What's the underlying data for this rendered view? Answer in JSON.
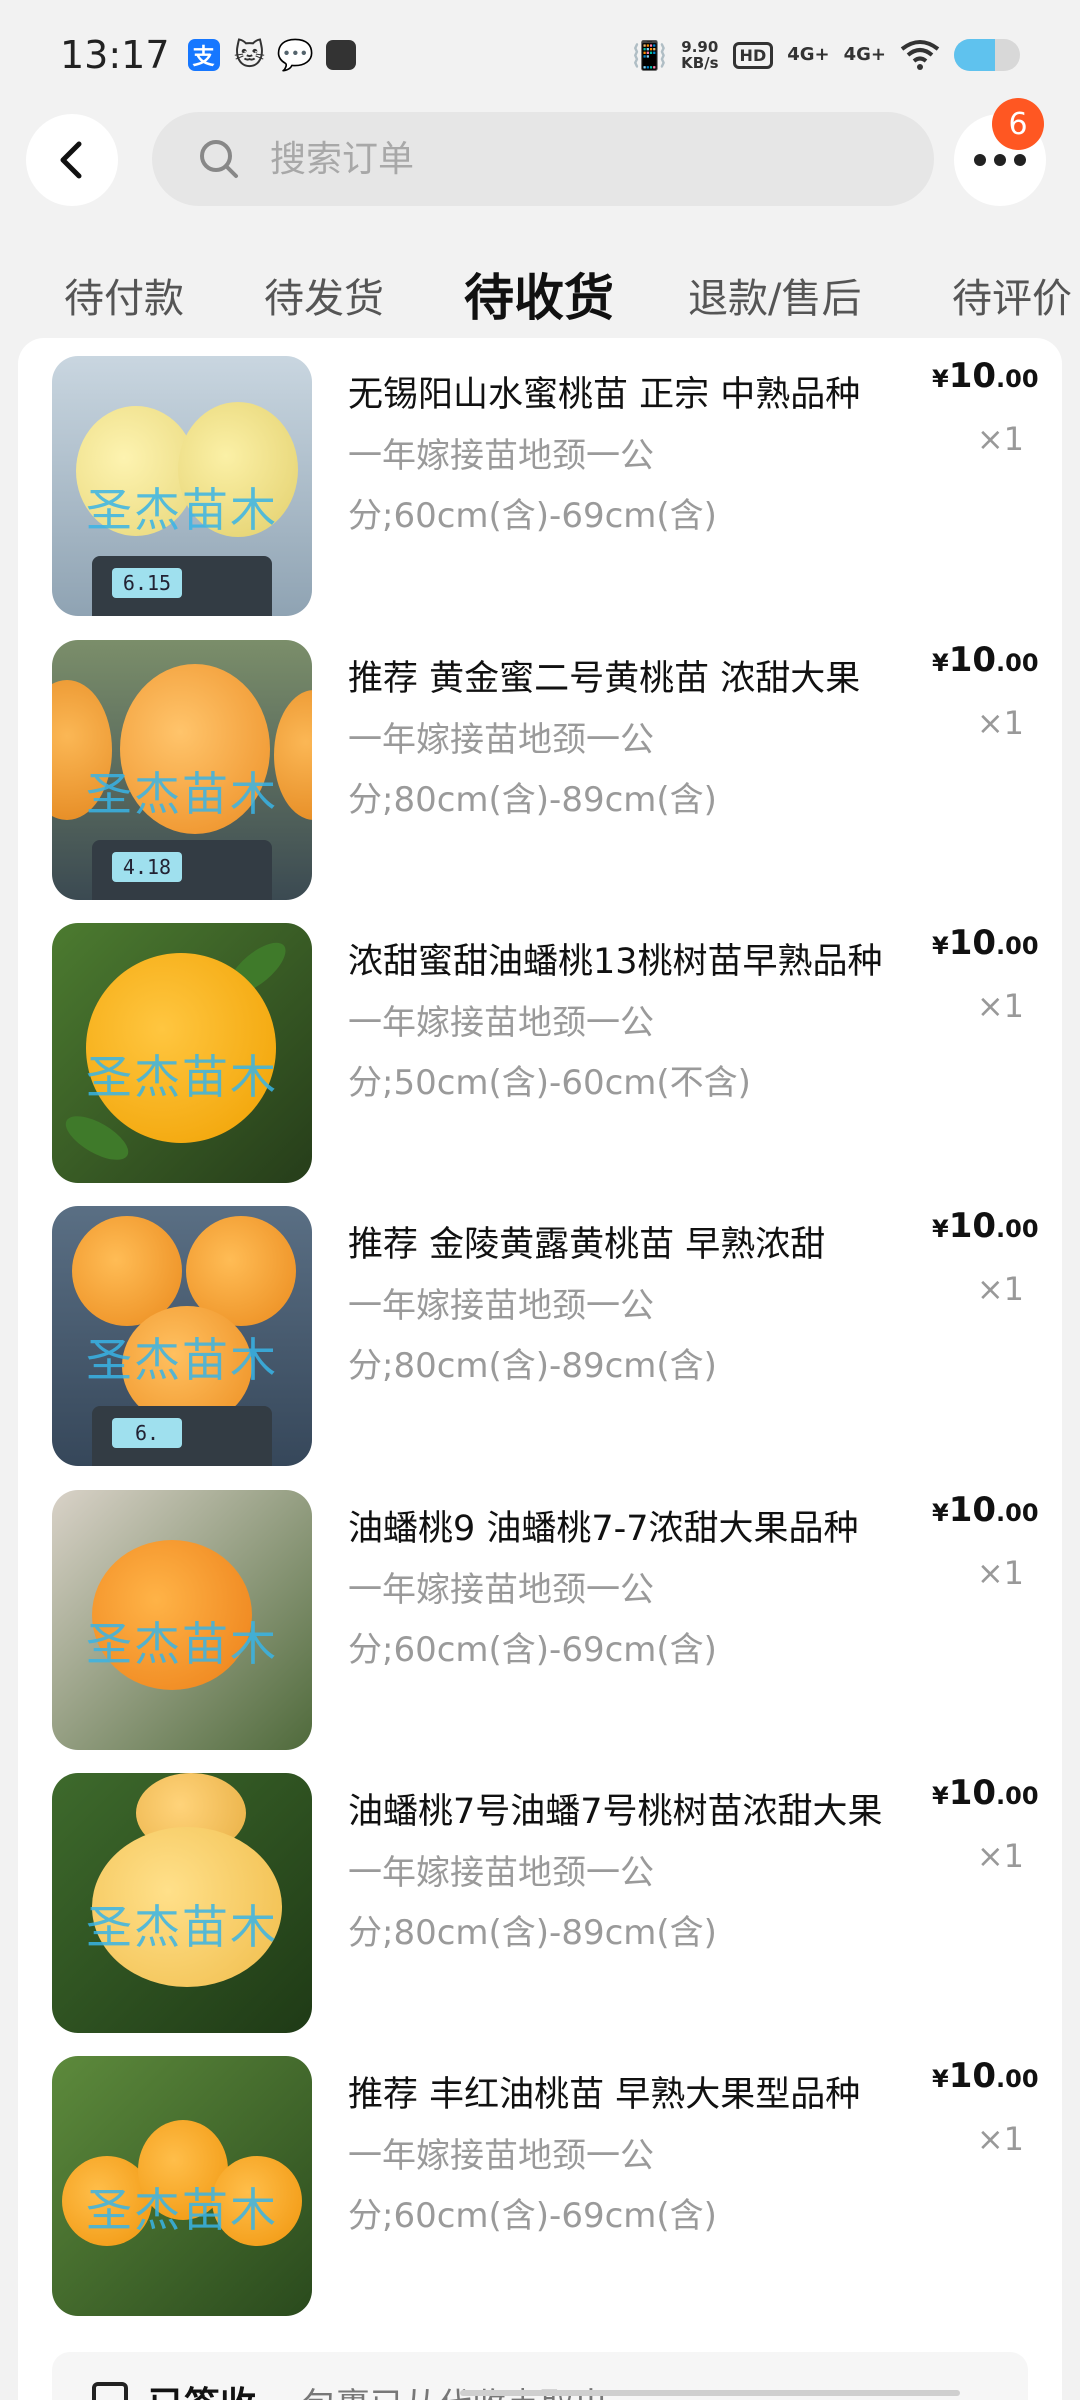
{
  "status_bar": {
    "time": "13:17",
    "speed_top": "9.90",
    "speed_unit": "KB/s",
    "hd": "HD",
    "net1": "4G+",
    "net2": "4G+",
    "battery_level": 0.62,
    "app_icons": [
      "alipay-icon",
      "cat-icon",
      "wechat-icon",
      "box-icon"
    ]
  },
  "header": {
    "search_placeholder": "搜索订单",
    "more_badge": "6"
  },
  "tabs": [
    {
      "label": "待付款"
    },
    {
      "label": "待发货"
    },
    {
      "label": "待收货",
      "active": true
    },
    {
      "label": "退款/售后"
    },
    {
      "label": "待评价"
    }
  ],
  "items": [
    {
      "title": "无锡阳山水蜜桃苗 正宗 中熟品种",
      "spec": "一年嫁接苗地颈一公分;60cm(含)-69cm(含)",
      "price_currency": "¥",
      "price_int": "10",
      "price_dec": ".00",
      "qty": "×1",
      "scale_reading": "6.15"
    },
    {
      "title": "推荐 黄金蜜二号黄桃苗 浓甜大果",
      "spec": "一年嫁接苗地颈一公分;80cm(含)-89cm(含)",
      "price_currency": "¥",
      "price_int": "10",
      "price_dec": ".00",
      "qty": "×1",
      "scale_reading": "4.18"
    },
    {
      "title": "浓甜蜜甜油蟠桃13桃树苗早熟品种",
      "spec": "一年嫁接苗地颈一公分;50cm(含)-60cm(不含)",
      "price_currency": "¥",
      "price_int": "10",
      "price_dec": ".00",
      "qty": "×1",
      "scale_reading": ""
    },
    {
      "title": "推荐 金陵黄露黄桃苗 早熟浓甜",
      "spec": "一年嫁接苗地颈一公分;80cm(含)-89cm(含)",
      "price_currency": "¥",
      "price_int": "10",
      "price_dec": ".00",
      "qty": "×1",
      "scale_reading": "6."
    },
    {
      "title": "油蟠桃9 油蟠桃7-7浓甜大果品种",
      "spec": "一年嫁接苗地颈一公分;60cm(含)-69cm(含)",
      "price_currency": "¥",
      "price_int": "10",
      "price_dec": ".00",
      "qty": "×1",
      "scale_reading": ""
    },
    {
      "title": "油蟠桃7号油蟠7号桃树苗浓甜大果",
      "spec": "一年嫁接苗地颈一公分;80cm(含)-89cm(含)",
      "price_currency": "¥",
      "price_int": "10",
      "price_dec": ".00",
      "qty": "×1",
      "scale_reading": ""
    },
    {
      "title": "推荐 丰红油桃苗 早熟大果型品种",
      "spec": "一年嫁接苗地颈一公分;60cm(含)-69cm(含)",
      "price_currency": "¥",
      "price_int": "10",
      "price_dec": ".00",
      "qty": "×1",
      "scale_reading": ""
    }
  ],
  "watermark": "圣杰苗木",
  "delivery": {
    "status": "已签收",
    "message": "包裹已从代收点取出"
  }
}
